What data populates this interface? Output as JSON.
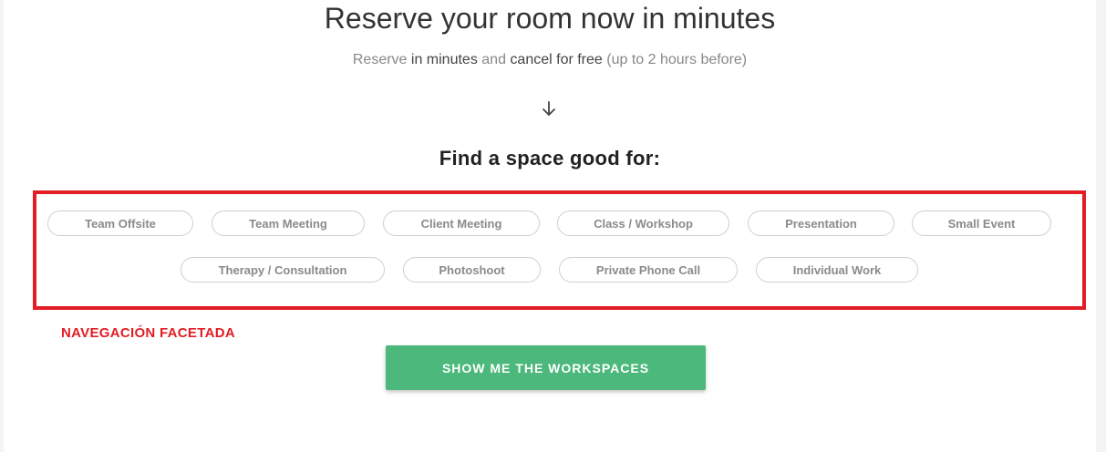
{
  "hero": {
    "title": "Reserve your room now in minutes",
    "subtitle": {
      "part1": "Reserve",
      "part2": "in minutes",
      "part3": "and",
      "part4": "cancel for free",
      "part5": "(up to 2 hours before)"
    },
    "arrow_icon": "arrow-down-icon"
  },
  "facets": {
    "title": "Find a space good for:",
    "items": [
      "Team Offsite",
      "Team Meeting",
      "Client Meeting",
      "Class / Workshop",
      "Presentation",
      "Small Event",
      "Therapy / Consultation",
      "Photoshoot",
      "Private Phone Call",
      "Individual Work"
    ],
    "annotation": "NAVEGACIÓN FACETADA",
    "highlight_color": "#e21d24"
  },
  "cta": {
    "label": "SHOW ME THE WORKSPACES",
    "color": "#4cb87b"
  }
}
